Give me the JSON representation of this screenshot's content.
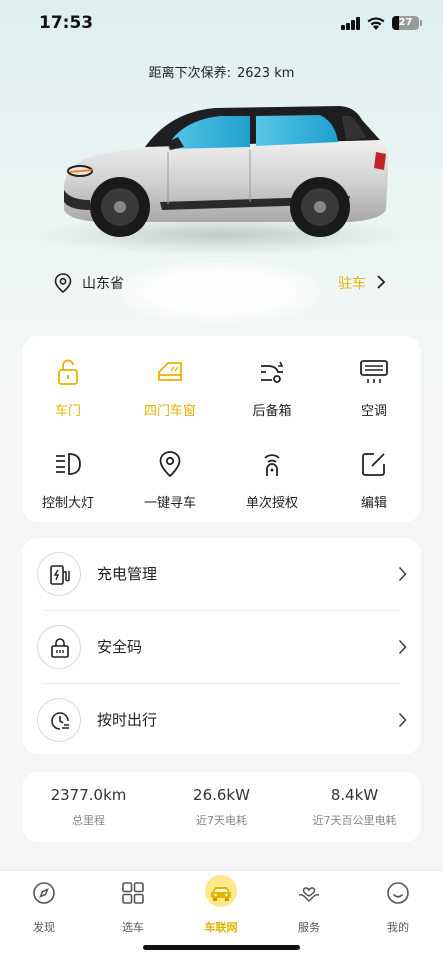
{
  "status_bar": {
    "time": "17:53",
    "battery": "27",
    "battery_level": 0.27
  },
  "maintenance": {
    "label": "距离下次保养:",
    "value": "2623 km"
  },
  "location": {
    "address": "山东省",
    "action": "驻车"
  },
  "controls": [
    {
      "label": "车门",
      "icon": "unlock-icon",
      "active": true
    },
    {
      "label": "四门车窗",
      "icon": "car-window-icon",
      "active": true
    },
    {
      "label": "后备箱",
      "icon": "trunk-icon",
      "active": false
    },
    {
      "label": "空调",
      "icon": "air-conditioner-icon",
      "active": false
    },
    {
      "label": "控制大灯",
      "icon": "headlight-icon",
      "active": false
    },
    {
      "label": "一键寻车",
      "icon": "location-pin-icon",
      "active": false
    },
    {
      "label": "单次授权",
      "icon": "key-auth-icon",
      "active": false
    },
    {
      "label": "编辑",
      "icon": "edit-icon",
      "active": false
    }
  ],
  "menu": [
    {
      "label": "充电管理",
      "icon": "charging-station-icon"
    },
    {
      "label": "安全码",
      "icon": "lock-code-icon"
    },
    {
      "label": "按时出行",
      "icon": "scheduled-trip-icon"
    }
  ],
  "stats": [
    {
      "value": "2377.0km",
      "label": "总里程"
    },
    {
      "value": "26.6kW",
      "label": "近7天电耗"
    },
    {
      "value": "8.4kW",
      "label": "近7天百公里电耗"
    }
  ],
  "tabs": [
    {
      "label": "发现",
      "icon": "compass-icon",
      "active": false
    },
    {
      "label": "选车",
      "icon": "grid-icon",
      "active": false
    },
    {
      "label": "车联网",
      "icon": "car-icon",
      "active": true
    },
    {
      "label": "服务",
      "icon": "service-heart-icon",
      "active": false
    },
    {
      "label": "我的",
      "icon": "smile-icon",
      "active": false
    }
  ],
  "colors": {
    "accent": "#e4b400",
    "background": "#f5f5f5",
    "card": "#ffffff",
    "hero_top": "#dcefee"
  }
}
